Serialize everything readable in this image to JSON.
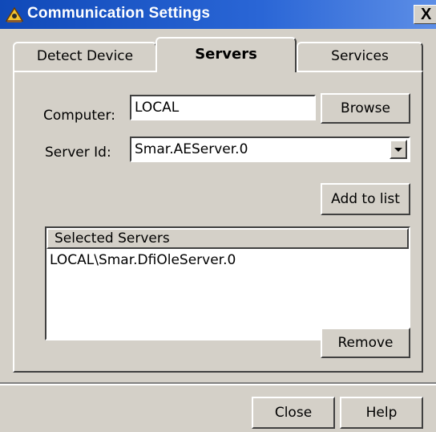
{
  "window": {
    "title": "Communication Settings",
    "close_glyph": "X"
  },
  "tabs": [
    {
      "label": "Detect Device",
      "active": false
    },
    {
      "label": "Servers",
      "active": true
    },
    {
      "label": "Services",
      "active": false
    }
  ],
  "servers": {
    "computer_label": "Computer:",
    "computer_value": "LOCAL",
    "browse_label": "Browse",
    "server_id_label": "Server Id:",
    "server_id_value": "Smar.AEServer.0",
    "add_label": "Add to list",
    "list_header": "Selected Servers",
    "list_items": [
      "LOCAL\\Smar.DfiOleServer.0"
    ],
    "remove_label": "Remove"
  },
  "footer": {
    "close_label": "Close",
    "help_label": "Help"
  },
  "icons": {
    "title": "app-icon",
    "combo": "chevron-down-icon"
  },
  "colors": {
    "titlebar": "#1049b8",
    "face": "#d4d0c8"
  }
}
